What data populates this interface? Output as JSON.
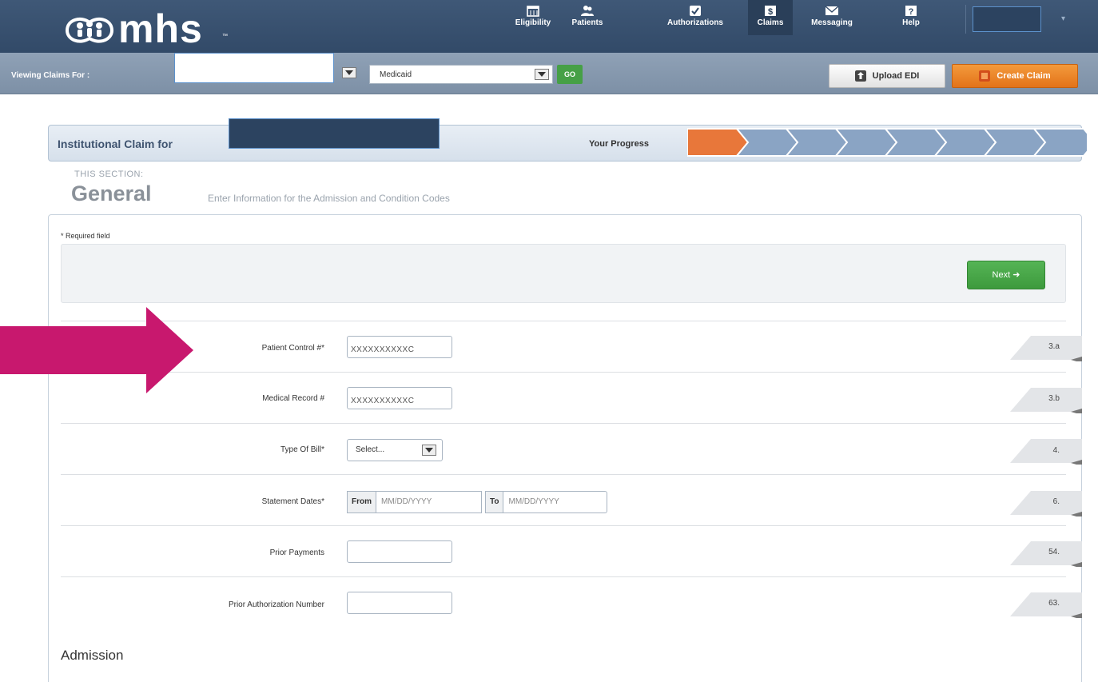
{
  "header": {
    "logo_text": "mhs",
    "logo_tm": "™",
    "nav": [
      {
        "label": "Eligibility",
        "icon": "calendar-icon",
        "active": false
      },
      {
        "label": "Patients",
        "icon": "people-icon",
        "active": false
      },
      {
        "label": "Authorizations",
        "icon": "checkbox-icon",
        "active": false
      },
      {
        "label": "Claims",
        "icon": "dollar-icon",
        "active": true
      },
      {
        "label": "Messaging",
        "icon": "envelope-icon",
        "active": false
      },
      {
        "label": "Help",
        "icon": "question-icon",
        "active": false
      }
    ]
  },
  "subbar": {
    "viewing_label": "Viewing Claims For :",
    "plan_value": "Medicaid",
    "go_label": "GO",
    "upload_label": "Upload EDI",
    "create_label": "Create Claim"
  },
  "claim": {
    "title": "Institutional Claim for",
    "progress_label": "Your Progress",
    "progress_steps_total": 8,
    "progress_current_step": 1
  },
  "section": {
    "caption": "THIS SECTION:",
    "title": "General",
    "description": "Enter Information for the Admission and Condition Codes"
  },
  "form": {
    "required_note": "* Required field",
    "next_label": "Next",
    "patient_control": {
      "label": "Patient Control #*",
      "value": "XXXXXXXXXXC",
      "box": "3.a"
    },
    "medical_record": {
      "label": "Medical Record #",
      "value": "XXXXXXXXXXC",
      "box": "3.b"
    },
    "type_of_bill": {
      "label": "Type Of Bill*",
      "value": "Select...",
      "box": "4."
    },
    "statement_dates": {
      "label": "Statement Dates*",
      "from_tag": "From",
      "from_placeholder": "MM/DD/YYYY",
      "to_tag": "To",
      "to_placeholder": "MM/DD/YYYY",
      "box": "6."
    },
    "prior_payments": {
      "label": "Prior Payments",
      "value": "",
      "box": "54."
    },
    "prior_auth": {
      "label": "Prior Authorization Number",
      "value": "",
      "box": "63."
    },
    "admission_heading": "Admission"
  },
  "colors": {
    "header_bg": "#324a68",
    "accent_orange": "#e8773a",
    "accent_green": "#46a046",
    "callout_arrow": "#c8186e",
    "progress_step": "#8aa4c4"
  }
}
